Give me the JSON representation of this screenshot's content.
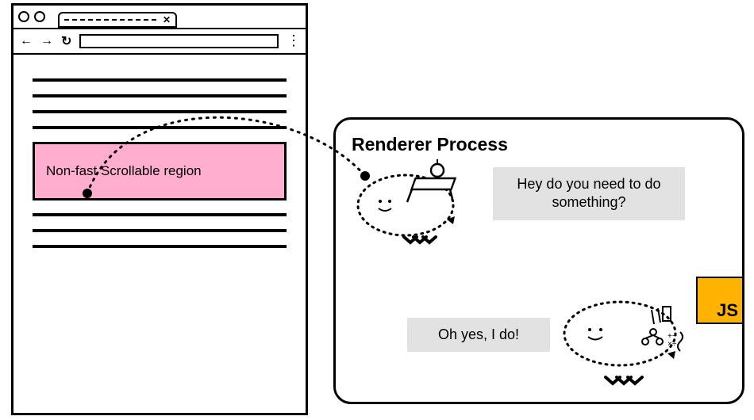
{
  "browser": {
    "region_label": "Non-fast Scrollable region"
  },
  "renderer": {
    "title": "Renderer Process",
    "bubble1": "Hey do you need to do something?",
    "bubble2": "Oh yes, I do!",
    "js_label": "JS"
  }
}
